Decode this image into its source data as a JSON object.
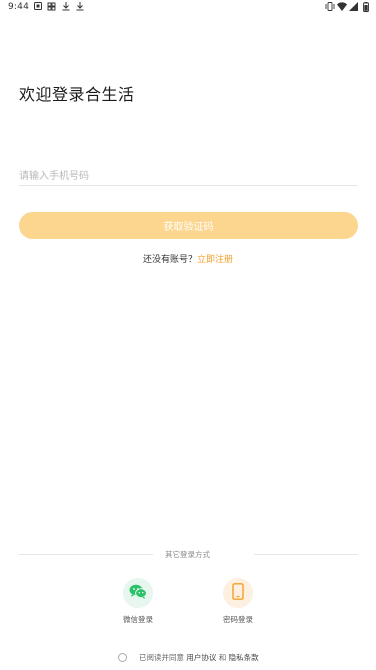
{
  "status_bar": {
    "time": "9:44",
    "left_icons": [
      "notification-icon",
      "app-icon",
      "download-icon",
      "download-icon"
    ],
    "right_icons": [
      "vibrate-icon",
      "wifi-icon",
      "signal-icon",
      "battery-icon"
    ]
  },
  "header": {
    "welcome_title": "欢迎登录合生活"
  },
  "form": {
    "phone_placeholder": "请输入手机号码",
    "get_code_label": "获取验证码"
  },
  "register": {
    "prompt": "还没有账号？",
    "link": "立即注册"
  },
  "other_login": {
    "divider_text": "其它登录方式",
    "wechat_label": "微信登录",
    "password_label": "密码登录"
  },
  "agreement": {
    "prefix": "已阅读并同意",
    "user_agreement": "用户协议",
    "and": "和",
    "privacy": "隐私条款"
  },
  "colors": {
    "accent": "#f0a028",
    "button_bg": "#fcd58e",
    "wechat_green": "#2bc168"
  }
}
